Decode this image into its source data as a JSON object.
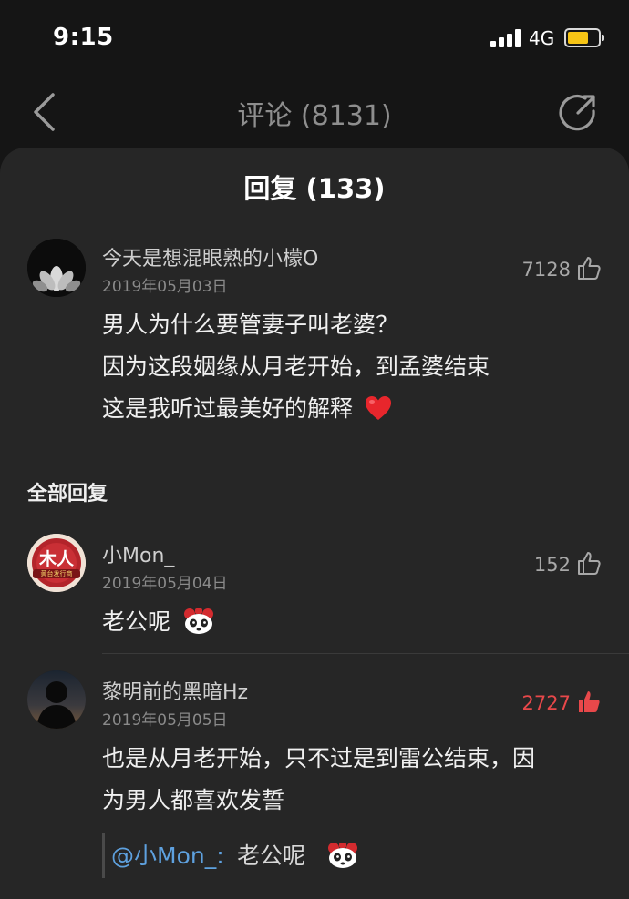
{
  "status_bar": {
    "time": "9:15",
    "network": "4G",
    "battery_level": 0.7
  },
  "nav": {
    "title": "评论 (8131)"
  },
  "sheet": {
    "title": "回复 (133)"
  },
  "main_comment": {
    "username": "今天是想混眼熟的小檬O",
    "date": "2019年05月03日",
    "likes": "7128",
    "lines": [
      "男人为什么要管妻子叫老婆？",
      "因为这段姻缘从月老开始，到孟婆结束",
      "这是我听过最美好的解释"
    ],
    "emoji": "heart"
  },
  "section_label": "全部回复",
  "replies": [
    {
      "username": "小Mon_",
      "date": "2019年05月04日",
      "likes": "152",
      "text": "老公呢",
      "avatar_text": "木人",
      "avatar_subtext": "黄台发行商"
    },
    {
      "username": "黎明前的黑暗Hz",
      "date": "2019年05月05日",
      "likes": "2727",
      "liked": true,
      "lines": [
        "也是从月老开始，只不过是到雷公结束，因",
        "为男人都喜欢发誓"
      ],
      "quote_mention": "@小Mon_:",
      "quote_text": "老公呢"
    }
  ],
  "colors": {
    "background": "#151515",
    "sheet": "#262626",
    "accent_like": "#e8484a",
    "mention": "#5ea1df",
    "battery": "#f6c415"
  }
}
